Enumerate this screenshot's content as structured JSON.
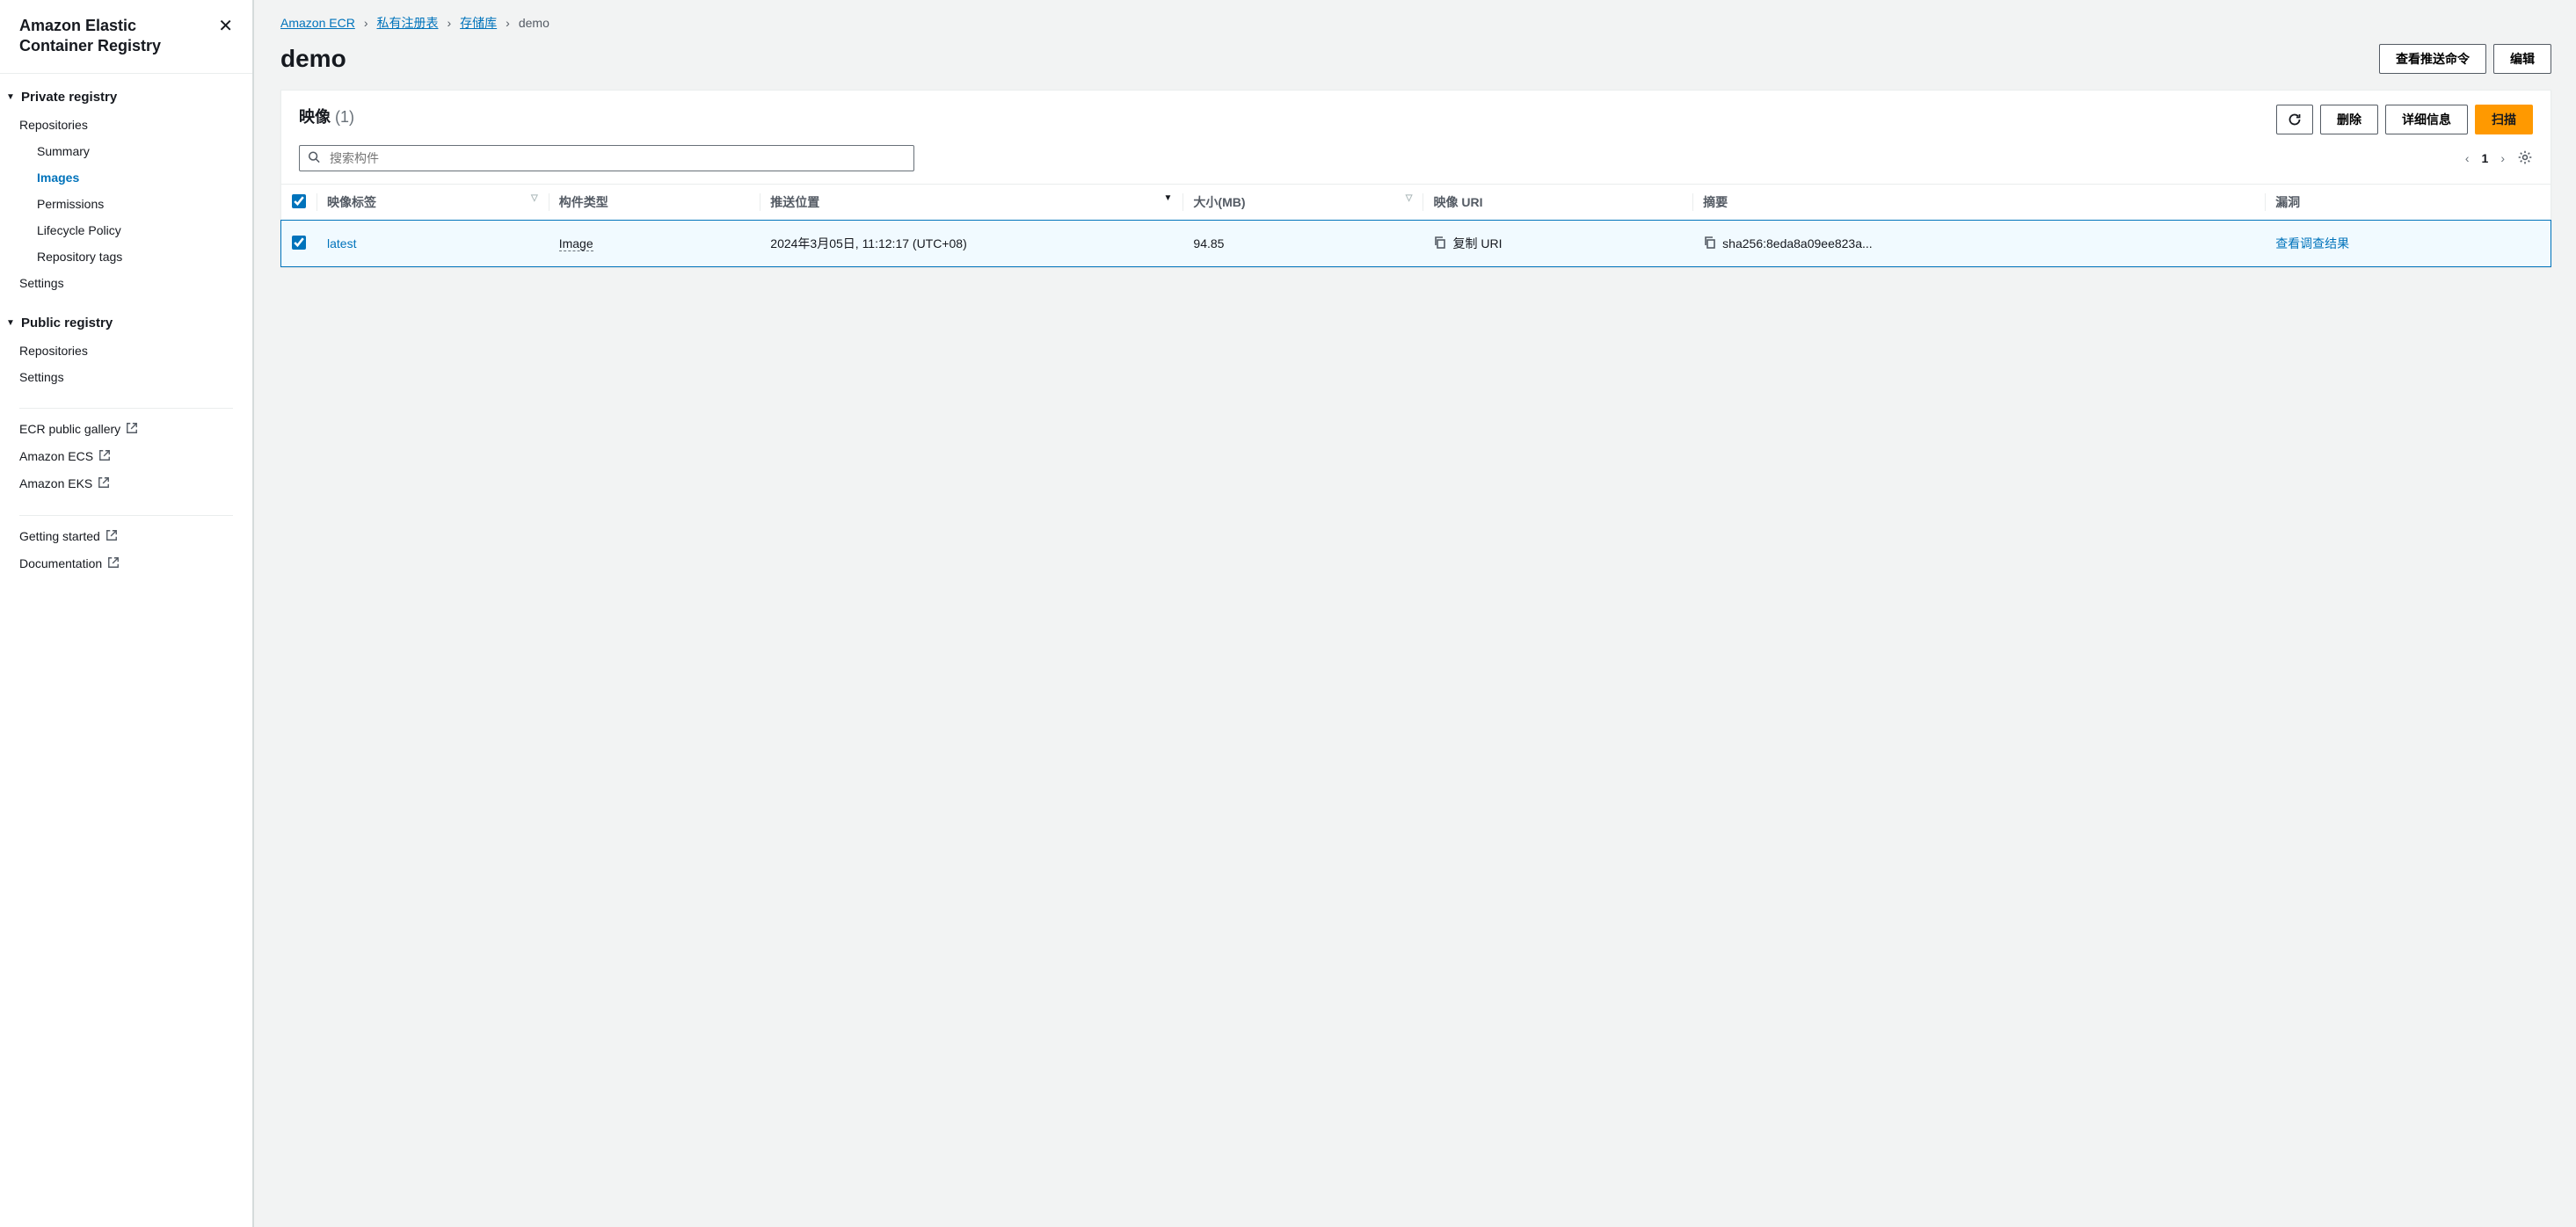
{
  "sidebar": {
    "title": "Amazon Elastic Container Registry",
    "sections": {
      "private": {
        "label": "Private registry",
        "items": [
          {
            "label": "Repositories"
          },
          {
            "label": "Summary"
          },
          {
            "label": "Images",
            "active": true
          },
          {
            "label": "Permissions"
          },
          {
            "label": "Lifecycle Policy"
          },
          {
            "label": "Repository tags"
          },
          {
            "label": "Settings"
          }
        ]
      },
      "public": {
        "label": "Public registry",
        "items": [
          {
            "label": "Repositories"
          },
          {
            "label": "Settings"
          }
        ]
      }
    },
    "external1": [
      {
        "label": "ECR public gallery"
      },
      {
        "label": "Amazon ECS"
      },
      {
        "label": "Amazon EKS"
      }
    ],
    "external2": [
      {
        "label": "Getting started"
      },
      {
        "label": "Documentation"
      }
    ]
  },
  "breadcrumbs": {
    "items": [
      {
        "label": "Amazon ECR",
        "link": true
      },
      {
        "label": "私有注册表",
        "link": true
      },
      {
        "label": "存储库",
        "link": true
      },
      {
        "label": "demo",
        "link": false
      }
    ]
  },
  "page": {
    "title": "demo",
    "view_push_cmd": "查看推送命令",
    "edit": "编辑"
  },
  "panel": {
    "title": "映像",
    "count": "(1)",
    "delete": "删除",
    "details": "详细信息",
    "scan": "扫描",
    "search_placeholder": "搜索构件",
    "page": "1"
  },
  "columns": {
    "tag": "映像标签",
    "artifact_type": "构件类型",
    "pushed_at": "推送位置",
    "size": "大小(MB)",
    "uri": "映像 URI",
    "digest": "摘要",
    "vuln": "漏洞"
  },
  "rows": [
    {
      "tag": "latest",
      "artifact_type": "Image",
      "pushed_at": "2024年3月05日, 11:12:17 (UTC+08)",
      "size": "94.85",
      "uri_label": "复制 URI",
      "digest": "sha256:8eda8a09ee823a...",
      "vuln": "查看调查结果"
    }
  ]
}
